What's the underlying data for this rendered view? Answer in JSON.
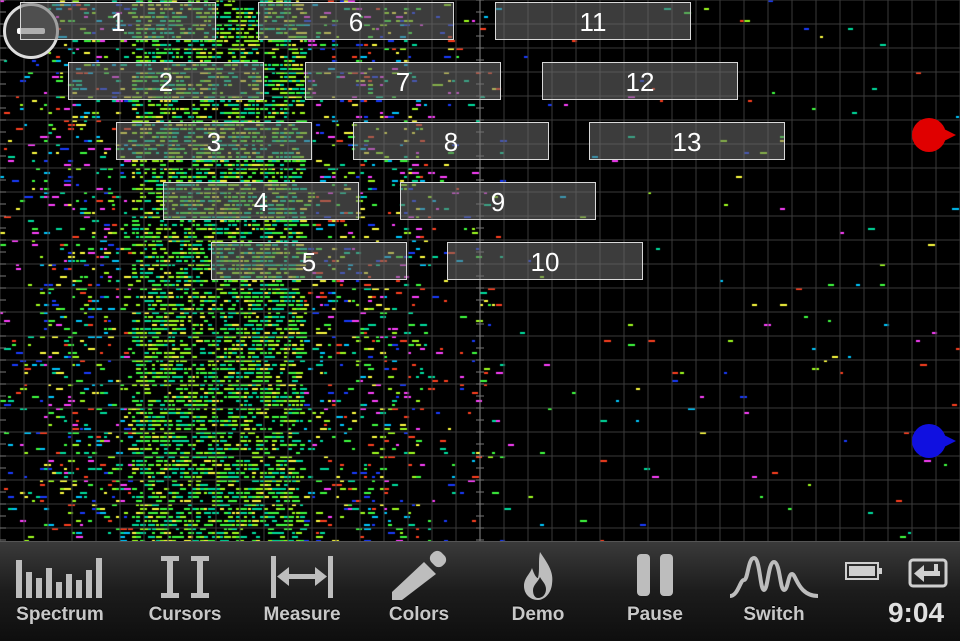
{
  "display": {
    "presets": [
      "1",
      "2",
      "3",
      "4",
      "5",
      "6",
      "7",
      "8",
      "9",
      "10",
      "11",
      "12",
      "13"
    ]
  },
  "markers": {
    "top_color": "#e00000",
    "bottom_color": "#1010e0"
  },
  "toolbar": {
    "items": [
      {
        "label": "Spectrum",
        "icon": "spectrum-bars-icon"
      },
      {
        "label": "Cursors",
        "icon": "cursors-icon"
      },
      {
        "label": "Measure",
        "icon": "measure-arrows-icon"
      },
      {
        "label": "Colors",
        "icon": "eyedropper-icon"
      },
      {
        "label": "Demo",
        "icon": "flame-icon"
      },
      {
        "label": "Pause",
        "icon": "pause-icon"
      },
      {
        "label": "Switch",
        "icon": "waveform-icon"
      }
    ],
    "clock": "9:04"
  }
}
